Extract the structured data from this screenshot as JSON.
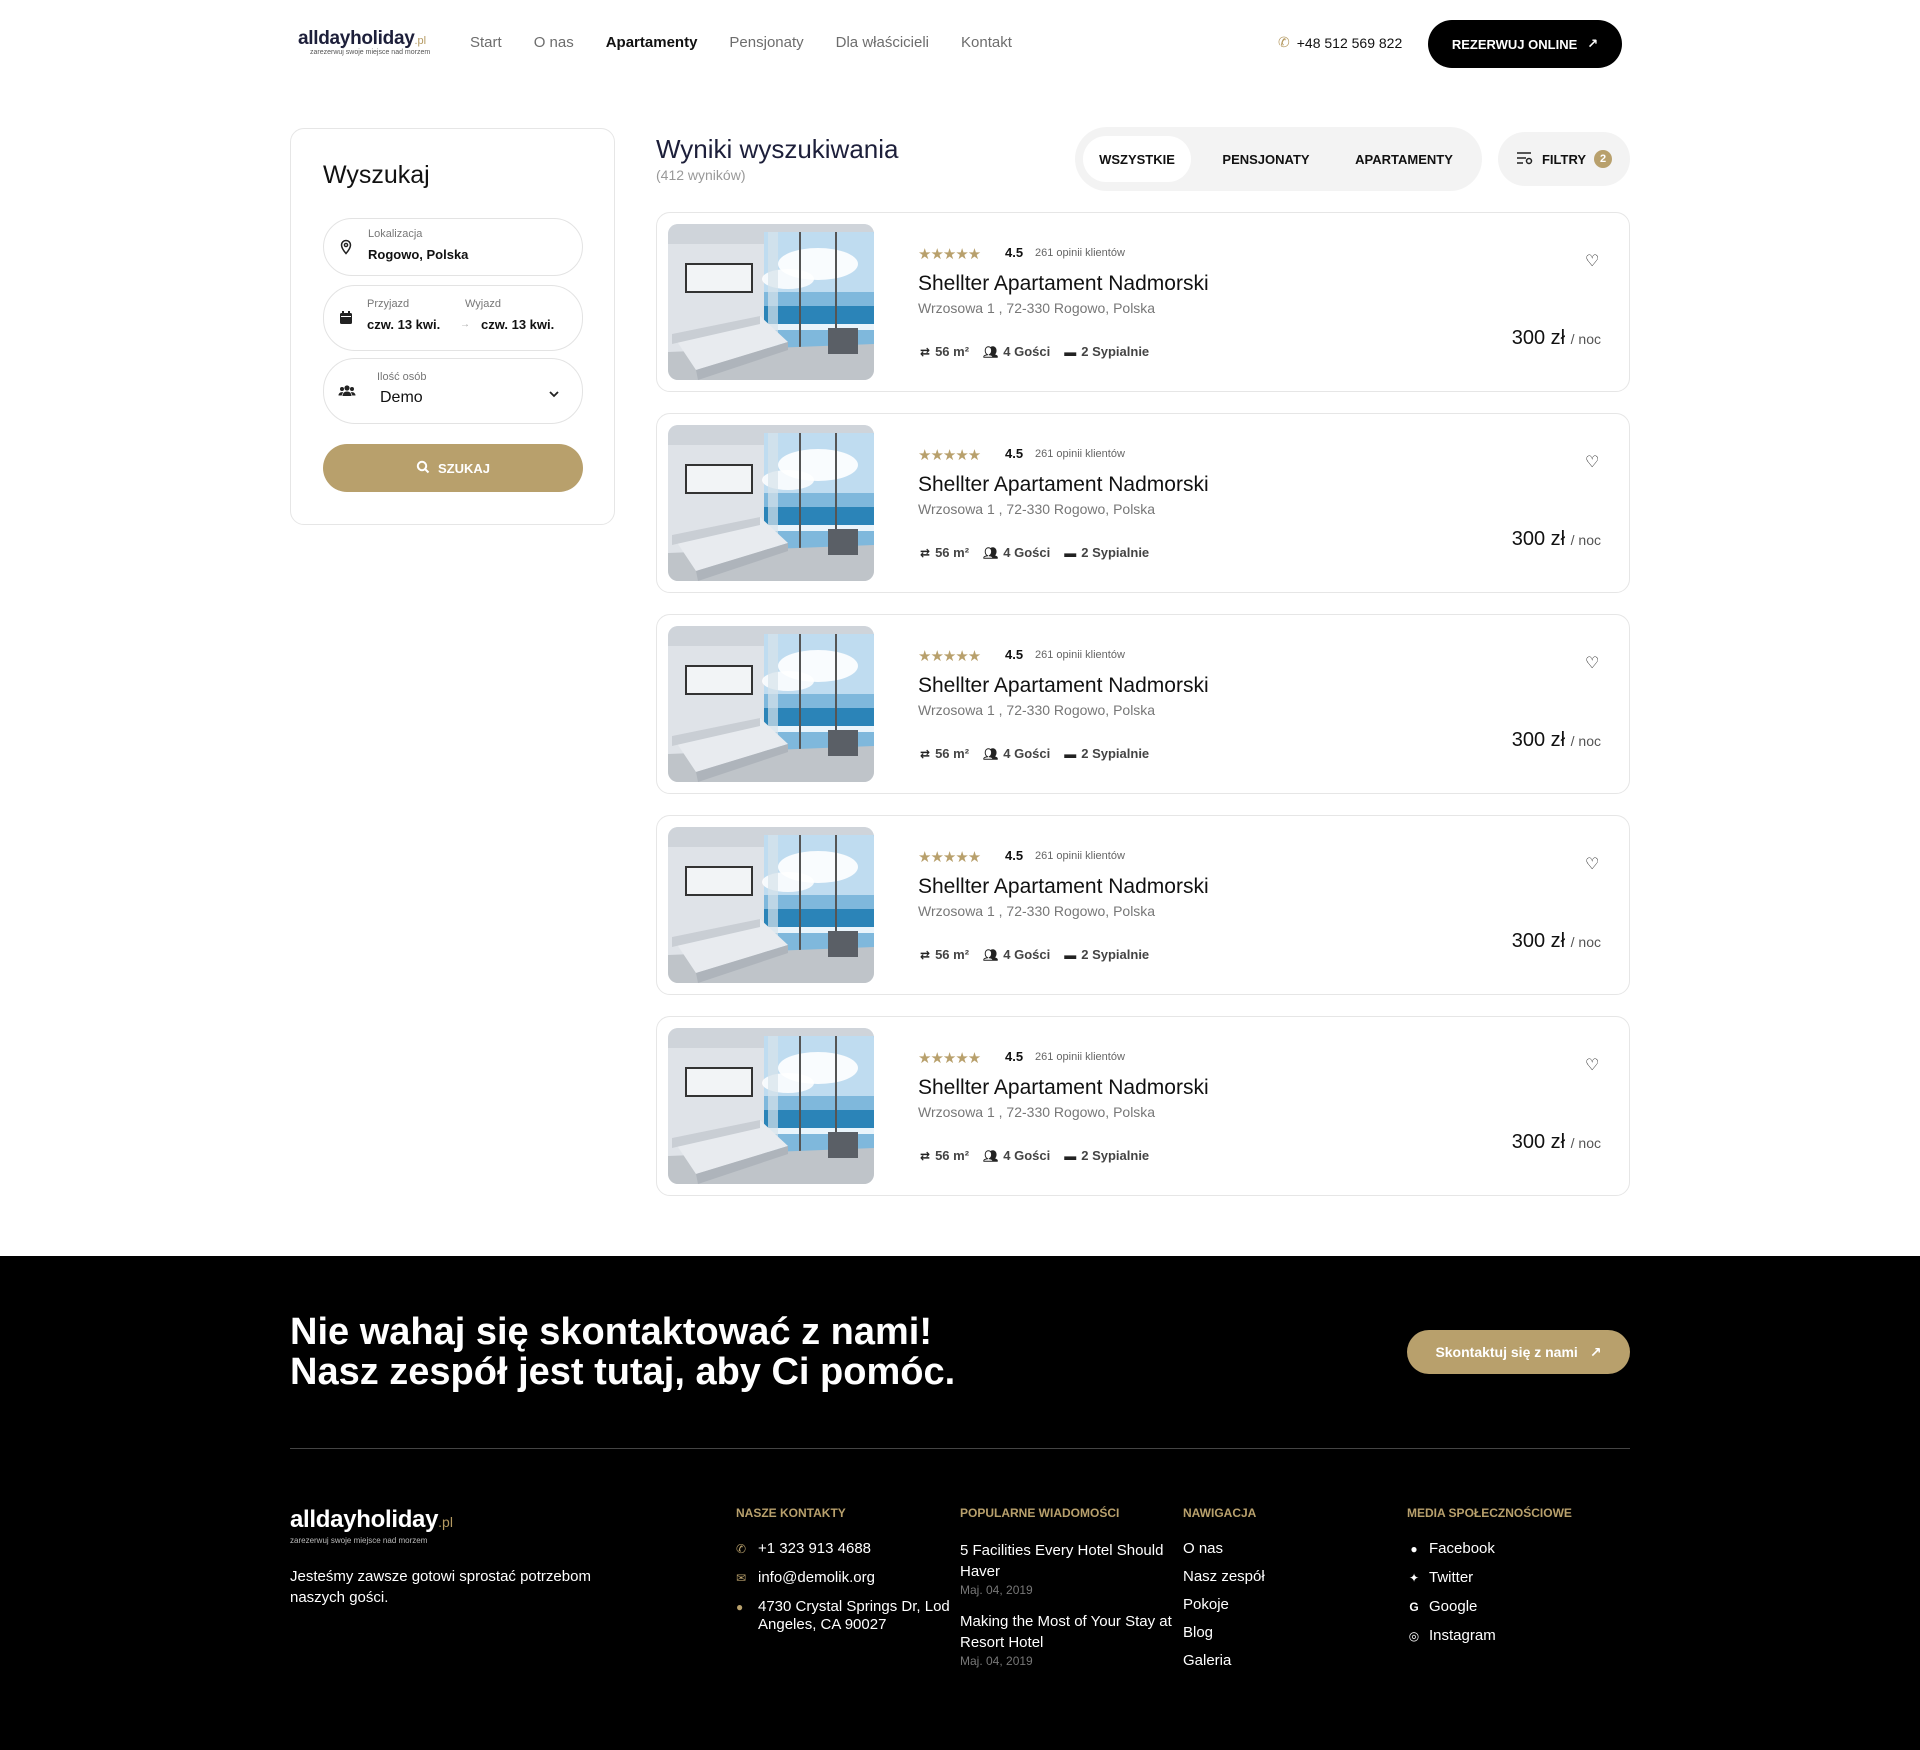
{
  "header": {
    "logo_main": "alldayholiday",
    "logo_tld": ".pl",
    "logo_sub": "zarezerwuj swoje miejsce nad morzem",
    "nav": [
      "Start",
      "O nas",
      "Apartamenty",
      "Pensjonaty",
      "Dla właścicieli",
      "Kontakt"
    ],
    "phone": "+48 512 569 822",
    "book_label": "REZERWUJ ONLINE"
  },
  "search": {
    "title": "Wyszukaj",
    "location_label": "Lokalizacja",
    "location_value": "Rogowo, Polska",
    "checkin_label": "Przyjazd",
    "checkin_value": "czw. 13 kwi.",
    "checkout_label": "Wyjazd",
    "checkout_value": "czw. 13 kwi.",
    "guests_label": "Ilość osób",
    "guests_value": "Demo",
    "button": "SZUKAJ"
  },
  "results": {
    "title": "Wyniki wyszukiwania",
    "count": "(412 wyników)",
    "tabs": [
      "WSZYSTKIE",
      "PENSJONATY",
      "APARTAMENTY"
    ],
    "filters_label": "FILTRY",
    "filters_count": "2"
  },
  "listings": [
    {
      "rating": "4.5",
      "reviews": "261 opinii klientów",
      "name": "Shellter Apartament Nadmorski",
      "address": "Wrzosowa 1 , 72-330 Rogowo, Polska",
      "area": "56 m²",
      "guests": "4 Gości",
      "bedrooms": "2 Sypialnie",
      "price": "300 zł",
      "unit": "/ noc"
    },
    {
      "rating": "4.5",
      "reviews": "261 opinii klientów",
      "name": "Shellter Apartament Nadmorski",
      "address": "Wrzosowa 1 , 72-330 Rogowo, Polska",
      "area": "56 m²",
      "guests": "4 Gości",
      "bedrooms": "2 Sypialnie",
      "price": "300 zł",
      "unit": "/ noc"
    },
    {
      "rating": "4.5",
      "reviews": "261 opinii klientów",
      "name": "Shellter Apartament Nadmorski",
      "address": "Wrzosowa 1 , 72-330 Rogowo, Polska",
      "area": "56 m²",
      "guests": "4 Gości",
      "bedrooms": "2 Sypialnie",
      "price": "300 zł",
      "unit": "/ noc"
    },
    {
      "rating": "4.5",
      "reviews": "261 opinii klientów",
      "name": "Shellter Apartament Nadmorski",
      "address": "Wrzosowa 1 , 72-330 Rogowo, Polska",
      "area": "56 m²",
      "guests": "4 Gości",
      "bedrooms": "2 Sypialnie",
      "price": "300 zł",
      "unit": "/ noc"
    },
    {
      "rating": "4.5",
      "reviews": "261 opinii klientów",
      "name": "Shellter Apartament Nadmorski",
      "address": "Wrzosowa 1 , 72-330 Rogowo, Polska",
      "area": "56 m²",
      "guests": "4 Gości",
      "bedrooms": "2 Sypialnie",
      "price": "300 zł",
      "unit": "/ noc"
    }
  ],
  "footer": {
    "cta_line1": "Nie wahaj się skontaktować z nami!",
    "cta_line2": "Nasz zespół jest tutaj, aby Ci pomóc.",
    "cta_button": "Skontaktuj się z nami",
    "logo_main": "alldayholiday",
    "logo_tld": ".pl",
    "logo_sub": "zarezerwuj swoje miejsce nad morzem",
    "about": "Jesteśmy zawsze gotowi sprostać potrzebom naszych gości.",
    "contacts_h": "NASZE KONTAKTY",
    "contacts": [
      "+1 323 913 4688",
      "info@demolik.org",
      "4730 Crystal Springs Dr, Lod Angeles, CA 90027"
    ],
    "news_h": "POPULARNE WIADOMOŚCI",
    "news": [
      {
        "title": "5 Facilities Every Hotel Should Haver",
        "date": "Maj. 04, 2019"
      },
      {
        "title": "Making the Most of Your Stay at Resort Hotel",
        "date": "Maj. 04, 2019"
      }
    ],
    "nav_h": "NAWIGACJA",
    "nav": [
      "O nas",
      "Nasz zespół",
      "Pokoje",
      "Blog",
      "Galeria"
    ],
    "social_h": "MEDIA SPOŁECZNOŚCIOWE",
    "social": [
      "Facebook",
      "Twitter",
      "Google",
      "Instagram"
    ]
  },
  "colors": {
    "accent": "#b8a06c",
    "dark": "#000000",
    "brand_navy": "#1d1f3a"
  }
}
